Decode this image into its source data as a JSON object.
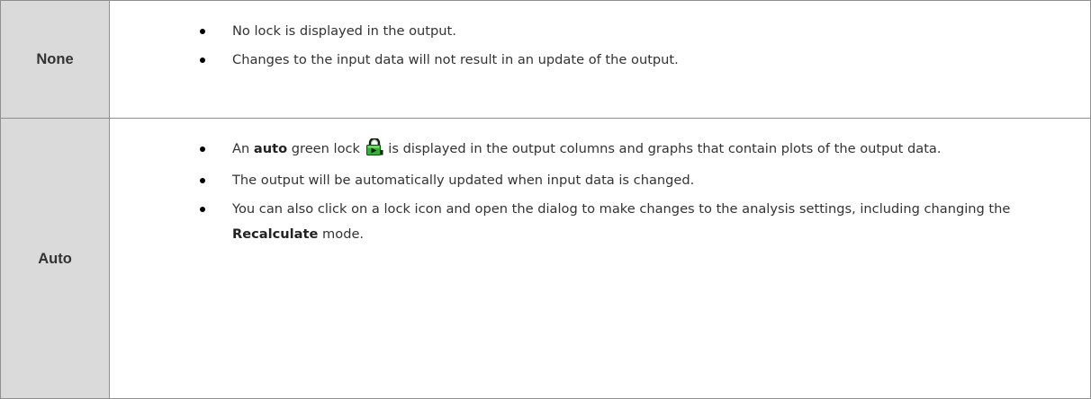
{
  "rows": [
    {
      "label": "None",
      "bullets": [
        {
          "text": "No lock is displayed in the output."
        },
        {
          "text": "Changes to the input data will not result in an update of the output."
        }
      ]
    },
    {
      "label": "Auto",
      "bullets": [
        {
          "pre": "An ",
          "bold": "auto",
          "mid": " green lock",
          "icon": "green-lock-icon",
          "post": " is displayed in the output columns and graphs that contain plots of the output data."
        },
        {
          "text": "The output will be automatically updated when input data is changed."
        },
        {
          "pre": "You can also click on a lock icon and open the dialog to make changes to the analysis settings, including changing the ",
          "bold": "Recalculate",
          "post": " mode."
        }
      ]
    }
  ],
  "colors": {
    "label_background": "#dadada",
    "border": "#8f8f8f",
    "text": "#333333",
    "lock_green": "#2fb52f"
  }
}
